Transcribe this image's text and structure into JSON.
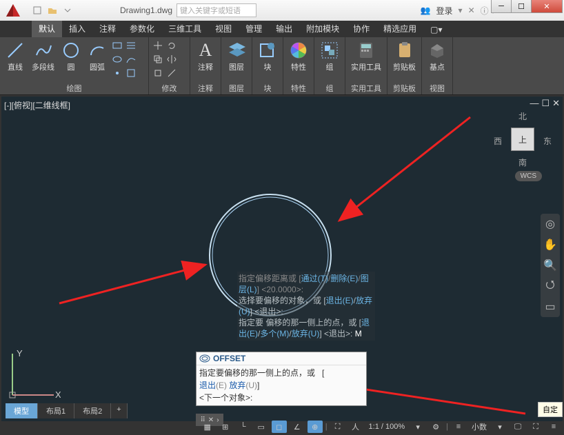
{
  "titlebar": {
    "doc_name": "Drawing1.dwg",
    "search_placeholder": "键入关键字或短语",
    "login": "登录"
  },
  "ribbon": {
    "tabs": [
      "默认",
      "插入",
      "注释",
      "参数化",
      "三维工具",
      "视图",
      "管理",
      "输出",
      "附加模块",
      "协作",
      "精选应用"
    ],
    "draw": {
      "label": "绘图",
      "line": "直线",
      "polyline": "多段线",
      "circle": "圆",
      "arc": "圆弧"
    },
    "modify": {
      "label": "修改"
    },
    "annot": {
      "label": "注释"
    },
    "layer": {
      "label": "图层"
    },
    "block": {
      "label": "块"
    },
    "prop": {
      "label": "特性"
    },
    "group": {
      "label": "组"
    },
    "util": {
      "label": "实用工具"
    },
    "clip": {
      "label": "剪贴板"
    },
    "base": {
      "label": "基点"
    },
    "view": {
      "label": "视图"
    }
  },
  "viewport": {
    "title": "[-][俯视][二维线框]",
    "cube": {
      "n": "北",
      "s": "南",
      "e": "东",
      "w": "西",
      "top": "上"
    },
    "wcs": "WCS"
  },
  "cmd_history": {
    "l1a": "指定偏移距离或 [",
    "l1b": "通过(T)",
    "l1c": "/",
    "l1d": "删除(E)",
    "l1e": "/",
    "l1f": "图层(L)",
    "l1g": "] <20.0000>:",
    "l2a": "选择要偏移的对象，或 [",
    "l2b": "退出(E)",
    "l2c": "/",
    "l2d": "放弃(U)",
    "l2e": "] <退出>:",
    "l3a": "指定要 偏移的那一侧上的点，或 [",
    "l3b": "退出(E)",
    "l3c": "/",
    "l3d": "多个(M)",
    "l3e": "/",
    "l3f": "放弃(U)",
    "l3g": "] <退出>:  ",
    "l3h": "M"
  },
  "cmd_box": {
    "name": "OFFSET",
    "prompt": "指定要偏移的那一侧上的点，或",
    "opt_exit": "退出",
    "key_exit": "(E)",
    "opt_undo": "放弃",
    "key_undo": "(U)",
    "next": "<下一个对象>:",
    "bracket": "["
  },
  "tabs": {
    "model": "模型",
    "layout1": "布局1",
    "layout2": "布局2",
    "add": "+"
  },
  "status": {
    "scale": "1:1 / 100%",
    "decimal": "小数"
  },
  "tooltip": "自定",
  "axes": {
    "x": "X",
    "y": "Y"
  }
}
